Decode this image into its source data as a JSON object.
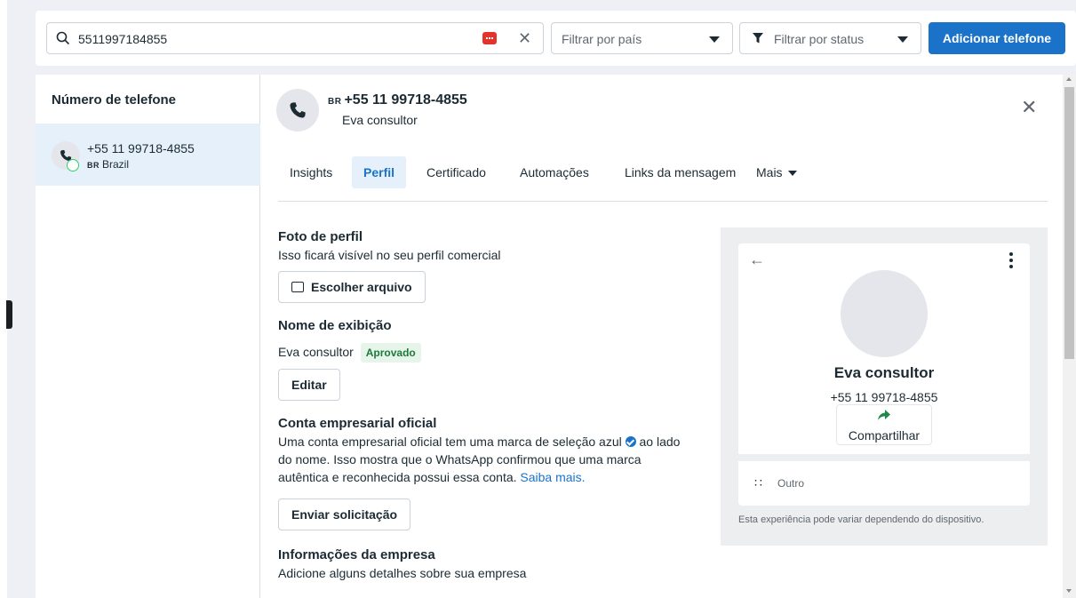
{
  "toolbar": {
    "search_value": "5511997184855",
    "country_filter_placeholder": "Filtrar por país",
    "status_filter_placeholder": "Filtrar por status",
    "add_phone_label": "Adicionar telefone"
  },
  "sidebar": {
    "header": "Número de telefone",
    "items": [
      {
        "number": "+55 11 99718-4855",
        "country_code": "BR",
        "country": "Brazil"
      }
    ]
  },
  "detail": {
    "country_code": "BR",
    "phone": "+55 11 99718-4855",
    "display_name": "Eva consultor",
    "tabs": [
      {
        "label": "Insights"
      },
      {
        "label": "Perfil",
        "active": true
      },
      {
        "label": "Certificado"
      },
      {
        "label": "Automações"
      },
      {
        "label": "Links da mensagem"
      },
      {
        "label": "Mais"
      }
    ],
    "photo": {
      "title": "Foto de perfil",
      "description": "Isso ficará visível no seu perfil comercial",
      "button": "Escolher arquivo"
    },
    "display_name_section": {
      "title": "Nome de exibição",
      "value": "Eva consultor",
      "status": "Aprovado",
      "button": "Editar"
    },
    "official_account": {
      "title": "Conta empresarial oficial",
      "line1_before": "Uma conta empresarial oficial tem uma marca de seleção azul",
      "line1_after": "ao lado",
      "line2": "do nome. Isso mostra que o WhatsApp confirmou que uma marca",
      "line3": "autêntica e reconhecida possui essa conta.",
      "link": "Saiba mais.",
      "button": "Enviar solicitação"
    },
    "company_info": {
      "title": "Informações da empresa",
      "description": "Adicione alguns detalhes sobre sua empresa"
    },
    "preview": {
      "name": "Eva consultor",
      "phone": "+55 11 99718-4855",
      "share_label": "Compartilhar",
      "category": "Outro",
      "note": "Esta experiência pode variar dependendo do dispositivo."
    }
  },
  "icons": {
    "search": "search-icon",
    "clear": "close-icon",
    "funnel": "filter-icon",
    "phone": "phone-icon",
    "whatsapp": "whatsapp-icon",
    "share": "share-arrow-icon",
    "category": "category-icon"
  },
  "colors": {
    "primary": "#1a73c8",
    "approved_bg": "#e6f4ea",
    "approved_text": "#1d7a3a",
    "selected_bg": "#e6f0fb"
  }
}
